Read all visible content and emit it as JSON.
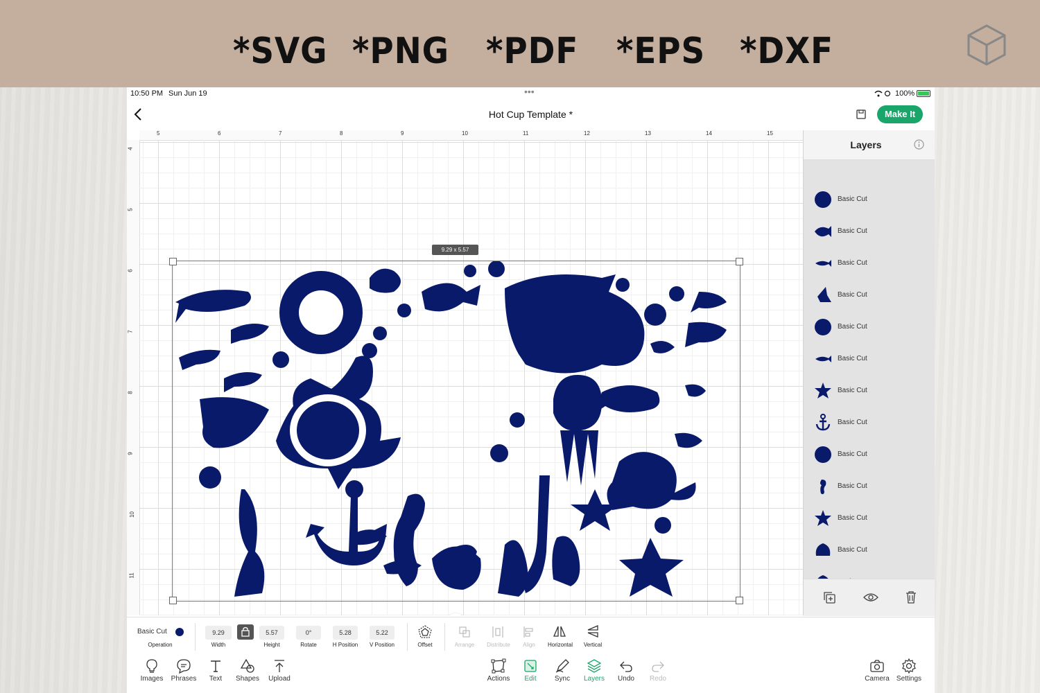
{
  "banner": {
    "formats": [
      "*SVG",
      "*PNG",
      "*PDF",
      "*EPS",
      "*DXF"
    ]
  },
  "status_bar": {
    "time": "10:50 PM",
    "date": "Sun Jun 19",
    "battery": "100%"
  },
  "header": {
    "title": "Hot Cup Template *",
    "make_it": "Make It"
  },
  "ruler": {
    "top": [
      "5",
      "6",
      "7",
      "8",
      "9",
      "10",
      "11",
      "12",
      "13",
      "14",
      "15"
    ],
    "left": [
      "4",
      "5",
      "6",
      "7",
      "8",
      "9",
      "10",
      "11"
    ]
  },
  "canvas": {
    "size_badge": "9.29 x 5.57",
    "accent": "#0a1a6b"
  },
  "layers": {
    "title": "Layers",
    "items": [
      "Basic Cut",
      "Basic Cut",
      "Basic Cut",
      "Basic Cut",
      "Basic Cut",
      "Basic Cut",
      "Basic Cut",
      "Basic Cut",
      "Basic Cut",
      "Basic Cut",
      "Basic Cut",
      "Basic Cut",
      "Basic Cut"
    ],
    "icons": [
      "circle-icon",
      "reef-fish-icon",
      "fish-icon",
      "angelfish-icon",
      "circle-icon",
      "fish-icon",
      "star-icon",
      "anchor-icon",
      "circle-icon",
      "seahorse-icon",
      "star-icon",
      "shell-icon",
      "shell-icon"
    ]
  },
  "properties": {
    "operation_value": "Basic Cut",
    "operation_label": "Operation",
    "width_value": "9.29",
    "width_label": "Width",
    "height_value": "5.57",
    "height_label": "Height",
    "rotate_value": "0°",
    "rotate_label": "Rotate",
    "hpos_value": "5.28",
    "hpos_label": "H Position",
    "vpos_value": "5.22",
    "vpos_label": "V Position",
    "offset_label": "Offset",
    "arrange_label": "Arrange",
    "distribute_label": "Distribute",
    "align_label": "Align",
    "horizontal_label": "Horizontal",
    "vertical_label": "Vertical"
  },
  "toolbar": {
    "images": "Images",
    "phrases": "Phrases",
    "text": "Text",
    "shapes": "Shapes",
    "upload": "Upload",
    "actions": "Actions",
    "edit": "Edit",
    "sync": "Sync",
    "layers": "Layers",
    "undo": "Undo",
    "redo": "Redo",
    "camera": "Camera",
    "settings": "Settings"
  }
}
